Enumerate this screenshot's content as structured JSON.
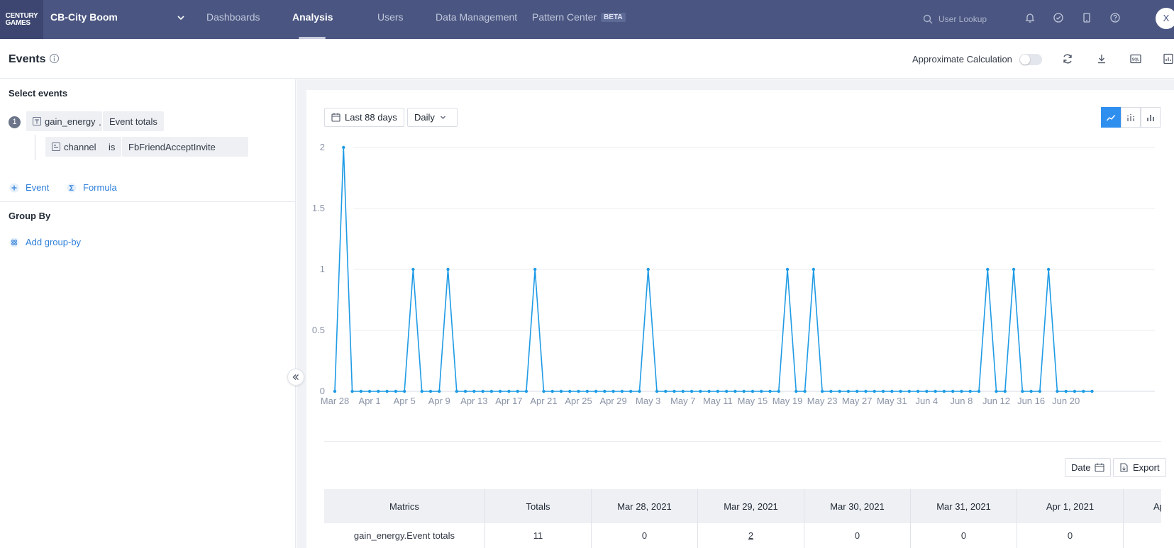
{
  "app": {
    "logo_text": "CENTURY GAMES",
    "logo_line1": "CENTURY",
    "logo_line2": "GAMES",
    "project": "CB-City Boom",
    "nav": [
      {
        "label": "Dashboards",
        "active": false
      },
      {
        "label": "Analysis",
        "active": true
      },
      {
        "label": "Users",
        "active": false
      },
      {
        "label": "Data Management",
        "active": false
      },
      {
        "label": "Pattern Center",
        "active": false,
        "badge": "BETA"
      }
    ],
    "search_placeholder": "User Lookup",
    "avatar_initial": "X",
    "icons": [
      "bell-icon",
      "check-circle-icon",
      "tablet-icon",
      "help-icon"
    ]
  },
  "subheader": {
    "title": "Events",
    "approx_label": "Approximate Calculation",
    "approx_enabled": false,
    "actions": [
      "refresh-icon",
      "download-icon",
      "sql-icon",
      "report-icon"
    ]
  },
  "left": {
    "select_events_title": "Select events",
    "event": {
      "index": "1",
      "name": "gain_energy",
      "separator": ".",
      "metric": "Event totals",
      "filter": {
        "property": "channel",
        "operator": "is",
        "value": "FbFriendAcceptInvite"
      }
    },
    "add_event": "Event",
    "add_formula": "Formula",
    "group_by_title": "Group By",
    "add_group_by": "Add group-by"
  },
  "controls": {
    "date_range": "Last 88 days",
    "granularity": "Daily",
    "chart_types": [
      "line-chart-icon",
      "dot-bar-icon",
      "bar-chart-icon"
    ],
    "active_chart_type": "line-chart-icon"
  },
  "chart_data": {
    "type": "line",
    "title": "",
    "xlabel": "",
    "ylabel": "",
    "ylim": [
      0,
      2
    ],
    "yticks": [
      "0",
      "0.5",
      "1",
      "1.5",
      "2"
    ],
    "x_tick_labels": [
      "Mar 28",
      "Apr 1",
      "Apr 5",
      "Apr 9",
      "Apr 13",
      "Apr 17",
      "Apr 21",
      "Apr 25",
      "Apr 29",
      "May 3",
      "May 7",
      "May 11",
      "May 15",
      "May 19",
      "May 23",
      "May 27",
      "May 31",
      "Jun 4",
      "Jun 8",
      "Jun 12",
      "Jun 16",
      "Jun 20"
    ],
    "start_date": "2021-03-28",
    "series": [
      {
        "color": "#1f9be5",
        "values": [
          0,
          2,
          0,
          0,
          0,
          0,
          0,
          0,
          0,
          1,
          0,
          0,
          0,
          1,
          0,
          0,
          0,
          0,
          0,
          0,
          0,
          0,
          0,
          1,
          0,
          0,
          0,
          0,
          0,
          0,
          0,
          0,
          0,
          0,
          0,
          0,
          1,
          0,
          0,
          0,
          0,
          0,
          0,
          0,
          0,
          0,
          0,
          0,
          0,
          0,
          0,
          0,
          1,
          0,
          0,
          1,
          0,
          0,
          0,
          0,
          0,
          0,
          0,
          0,
          0,
          0,
          0,
          0,
          0,
          0,
          0,
          0,
          0,
          0,
          0,
          1,
          0,
          0,
          1,
          0,
          0,
          0,
          1,
          0,
          0,
          0,
          0,
          0
        ]
      }
    ]
  },
  "table": {
    "date_btn": "Date",
    "export_btn": "Export",
    "headers": [
      "Matrics",
      "Totals",
      "Mar 28, 2021",
      "Mar 29, 2021",
      "Mar 30, 2021",
      "Mar 31, 2021",
      "Apr 1, 2021",
      "Ap"
    ],
    "row": [
      "gain_energy.Event totals",
      "11",
      "0",
      "2",
      "0",
      "0",
      "0",
      ""
    ]
  }
}
